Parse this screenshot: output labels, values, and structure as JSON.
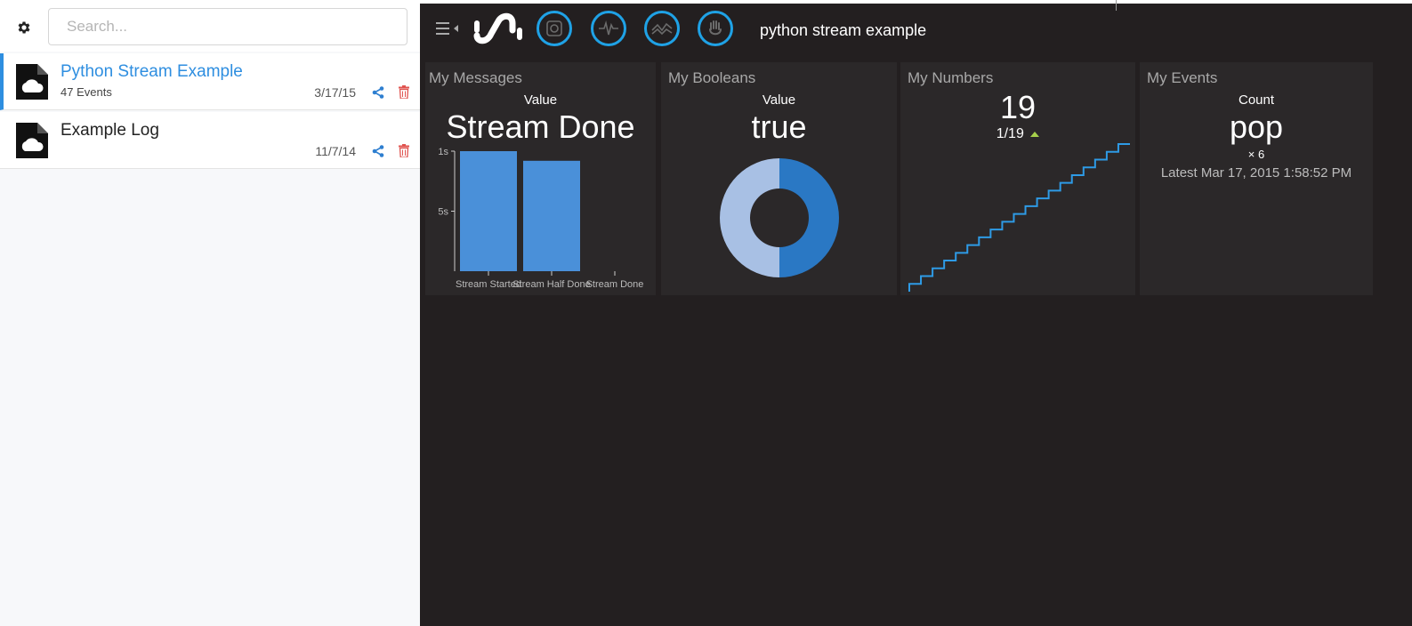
{
  "sidebar": {
    "search": {
      "placeholder": "Search..."
    },
    "items": [
      {
        "title": "Python Stream Example",
        "subtitle": "47 Events",
        "date": "3/17/15",
        "selected": true
      },
      {
        "title": "Example Log",
        "subtitle": "",
        "date": "11/7/14",
        "selected": false
      }
    ]
  },
  "header": {
    "stream_name": "python stream example",
    "icons": [
      "menu-toggle-icon",
      "logo-icon",
      "camera-icon",
      "waveform-icon",
      "line-chart-icon",
      "hand-icon"
    ]
  },
  "tiles": [
    {
      "title": "My Messages",
      "sub": "Value",
      "big": "Stream Done",
      "chart_data": {
        "type": "bar",
        "categories": [
          "Stream Started",
          "Stream Half Done",
          "Stream Done"
        ],
        "values": [
          1.0,
          0.92,
          0
        ],
        "y_ticks": [
          "1s",
          "5s"
        ],
        "color": "#4a90d9"
      }
    },
    {
      "title": "My Booleans",
      "sub": "Value",
      "big": "true",
      "chart_data": {
        "type": "pie",
        "labels": [
          "true",
          "false"
        ],
        "values": [
          0.5,
          0.5
        ],
        "colors": [
          "#2a78c4",
          "#a8c0e4"
        ]
      }
    },
    {
      "title": "My Numbers",
      "big": "19",
      "ratio": "1/19",
      "trend": "up",
      "trend_color": "#a6d04b",
      "chart_data": {
        "type": "line",
        "step": true,
        "x": [
          1,
          2,
          3,
          4,
          5,
          6,
          7,
          8,
          9,
          10,
          11,
          12,
          13,
          14,
          15,
          16,
          17,
          18,
          19
        ],
        "y": [
          1,
          2,
          3,
          4,
          5,
          6,
          7,
          8,
          9,
          10,
          11,
          12,
          13,
          14,
          15,
          16,
          17,
          18,
          19
        ],
        "color": "#2e9be6"
      }
    },
    {
      "title": "My Events",
      "sub": "Count",
      "big": "pop",
      "count": "× 6",
      "latest": "Latest Mar 17, 2015 1:58:52 PM"
    }
  ],
  "colors": {
    "accent": "#1fa2e6",
    "selected": "#2e8ee0",
    "background": "#231f20",
    "tile": "#2b2829"
  }
}
